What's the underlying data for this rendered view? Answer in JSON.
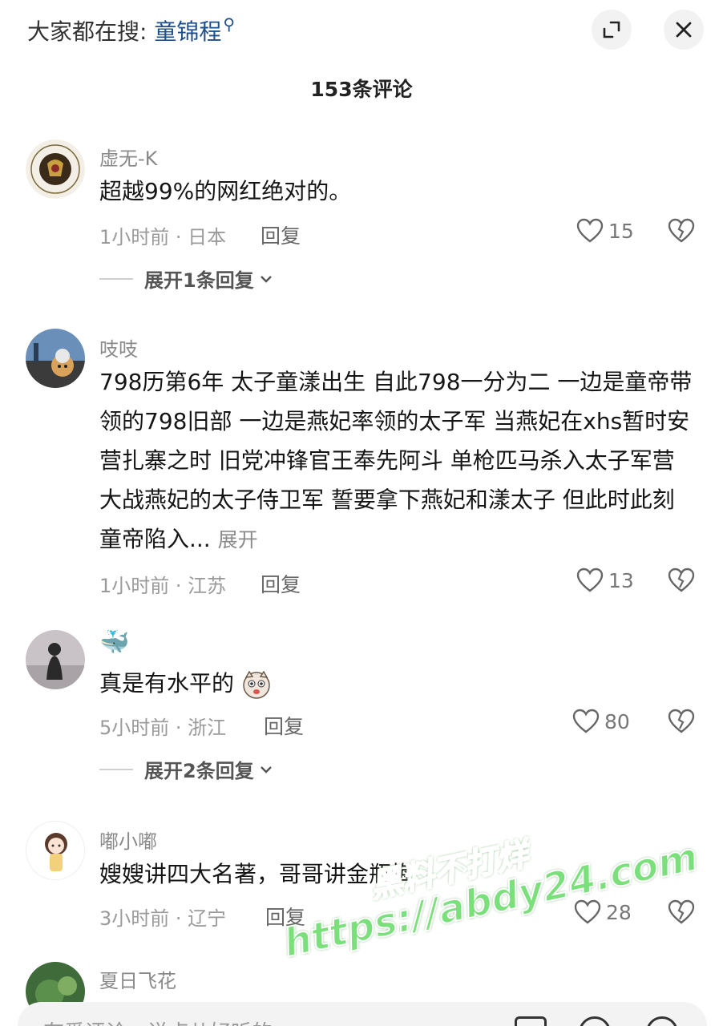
{
  "header": {
    "search_prefix": "大家都在搜:",
    "search_keyword": "童锦程",
    "comment_count": "153条评论",
    "icons": {
      "minimize": "minimize-icon",
      "close": "close-icon",
      "search": "search-icon"
    }
  },
  "comments": [
    {
      "username": "虚无-K",
      "text": "超越99%的网红绝对的。",
      "time_location": "1小时前 · 日本",
      "reply_label": "回复",
      "likes": "15",
      "expand_replies": "展开1条回复"
    },
    {
      "username": "吱吱",
      "text": "798历第6年 太子童漾出生 自此798一分为二 一边是童帝带领的798旧部 一边是燕妃率领的太子军 当燕妃在xhs暂时安营扎寨之时 旧党冲锋官王奉先阿斗 单枪匹马杀入太子军营 大战燕妃的太子侍卫军 誓要拿下燕妃和漾太子 但此时此刻 童帝陷入...",
      "expand_label": "展开",
      "time_location": "1小时前 · 江苏",
      "reply_label": "回复",
      "likes": "13"
    },
    {
      "username": "🐳",
      "text": "真是有水平的",
      "time_location": "5小时前 · 浙江",
      "reply_label": "回复",
      "likes": "80",
      "expand_replies": "展开2条回复"
    },
    {
      "username": "嘟小嘟",
      "text": "嫂嫂讲四大名著，哥哥讲金瓶梅",
      "time_location": "3小时前 · 辽宁",
      "reply_label": "回复",
      "likes": "28"
    },
    {
      "username": "夏日飞花"
    }
  ],
  "watermark": {
    "line1": "黑料不打烊",
    "line2": "https://abdy24.com"
  },
  "bottom_bar": {
    "placeholder": "有爱评论，说点儿好听的"
  }
}
